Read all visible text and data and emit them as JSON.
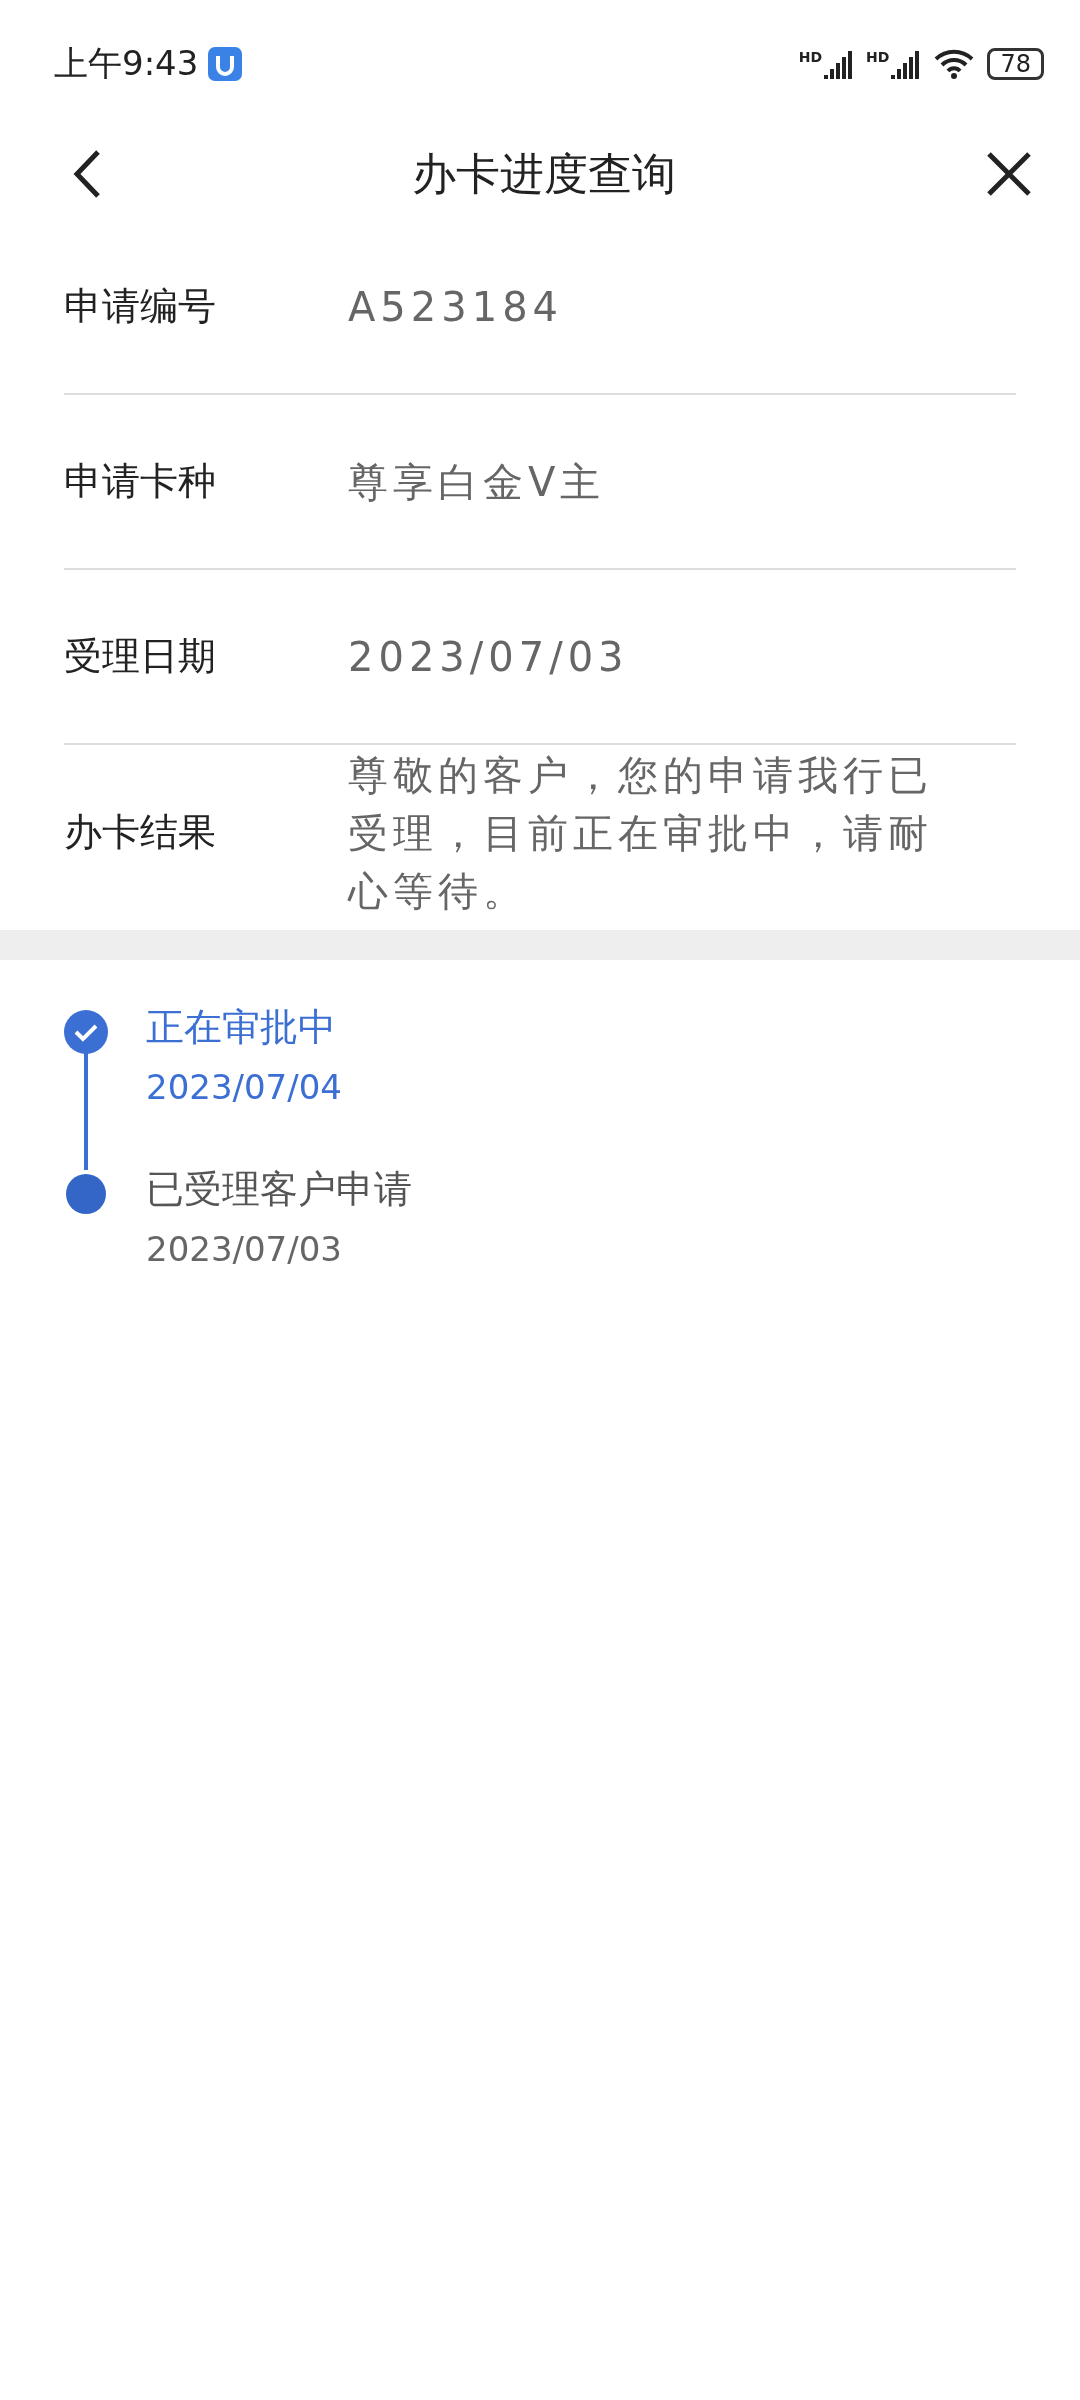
{
  "status_bar": {
    "time": "上午9:43",
    "network_badges": [
      "HD",
      "HD"
    ],
    "battery": "78"
  },
  "nav": {
    "title": "办卡进度查询"
  },
  "details": [
    {
      "label": "申请编号",
      "value": "A523184"
    },
    {
      "label": "申请卡种",
      "value": "尊享白金V主"
    },
    {
      "label": "受理日期",
      "value": "2023/07/03"
    },
    {
      "label": "办卡结果",
      "value": "尊敬的客户，您的申请我行已受理，目前正在审批中，请耐心等待。"
    }
  ],
  "timeline": [
    {
      "title": "正在审批中",
      "date": "2023/07/04",
      "active": true
    },
    {
      "title": "已受理客户申请",
      "date": "2023/07/03",
      "active": false
    }
  ]
}
